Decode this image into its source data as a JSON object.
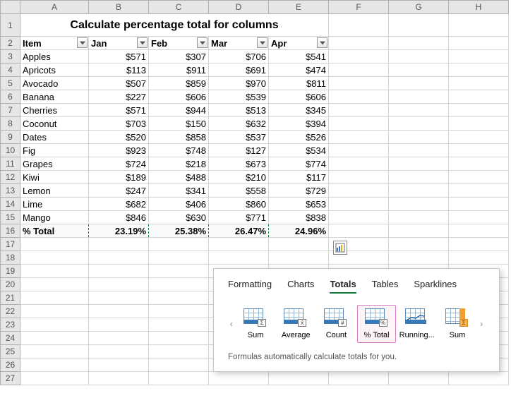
{
  "columns": [
    "A",
    "B",
    "C",
    "D",
    "E",
    "F",
    "G",
    "H"
  ],
  "rowNumbers": [
    1,
    2,
    3,
    4,
    5,
    6,
    7,
    8,
    9,
    10,
    11,
    12,
    13,
    14,
    15,
    16,
    17,
    18,
    19,
    20,
    21,
    22,
    23,
    24,
    25,
    26,
    27
  ],
  "title": "Calculate percentage total for columns",
  "headers": {
    "item": "Item",
    "jan": "Jan",
    "feb": "Feb",
    "mar": "Mar",
    "apr": "Apr"
  },
  "rows": [
    {
      "item": "Apples",
      "jan": "$571",
      "feb": "$307",
      "mar": "$706",
      "apr": "$541"
    },
    {
      "item": "Apricots",
      "jan": "$113",
      "feb": "$911",
      "mar": "$691",
      "apr": "$474"
    },
    {
      "item": "Avocado",
      "jan": "$507",
      "feb": "$859",
      "mar": "$970",
      "apr": "$811"
    },
    {
      "item": "Banana",
      "jan": "$227",
      "feb": "$606",
      "mar": "$539",
      "apr": "$606"
    },
    {
      "item": "Cherries",
      "jan": "$571",
      "feb": "$944",
      "mar": "$513",
      "apr": "$345"
    },
    {
      "item": "Coconut",
      "jan": "$703",
      "feb": "$150",
      "mar": "$632",
      "apr": "$394"
    },
    {
      "item": "Dates",
      "jan": "$520",
      "feb": "$858",
      "mar": "$537",
      "apr": "$526"
    },
    {
      "item": "Fig",
      "jan": "$923",
      "feb": "$748",
      "mar": "$127",
      "apr": "$534"
    },
    {
      "item": "Grapes",
      "jan": "$724",
      "feb": "$218",
      "mar": "$673",
      "apr": "$774"
    },
    {
      "item": "Kiwi",
      "jan": "$189",
      "feb": "$488",
      "mar": "$210",
      "apr": "$117"
    },
    {
      "item": "Lemon",
      "jan": "$247",
      "feb": "$341",
      "mar": "$558",
      "apr": "$729"
    },
    {
      "item": "Lime",
      "jan": "$682",
      "feb": "$406",
      "mar": "$860",
      "apr": "$653"
    },
    {
      "item": "Mango",
      "jan": "$846",
      "feb": "$630",
      "mar": "$771",
      "apr": "$838"
    }
  ],
  "totals": {
    "label": "% Total",
    "jan": "23.19%",
    "feb": "25.38%",
    "mar": "26.47%",
    "apr": "24.96%"
  },
  "quickAnalysis": {
    "tabs": [
      "Formatting",
      "Charts",
      "Totals",
      "Tables",
      "Sparklines"
    ],
    "activeTab": "Totals",
    "options": [
      "Sum",
      "Average",
      "Count",
      "% Total",
      "Running...",
      "Sum"
    ],
    "selected": "% Total",
    "hint": "Formulas automatically calculate totals for you."
  }
}
